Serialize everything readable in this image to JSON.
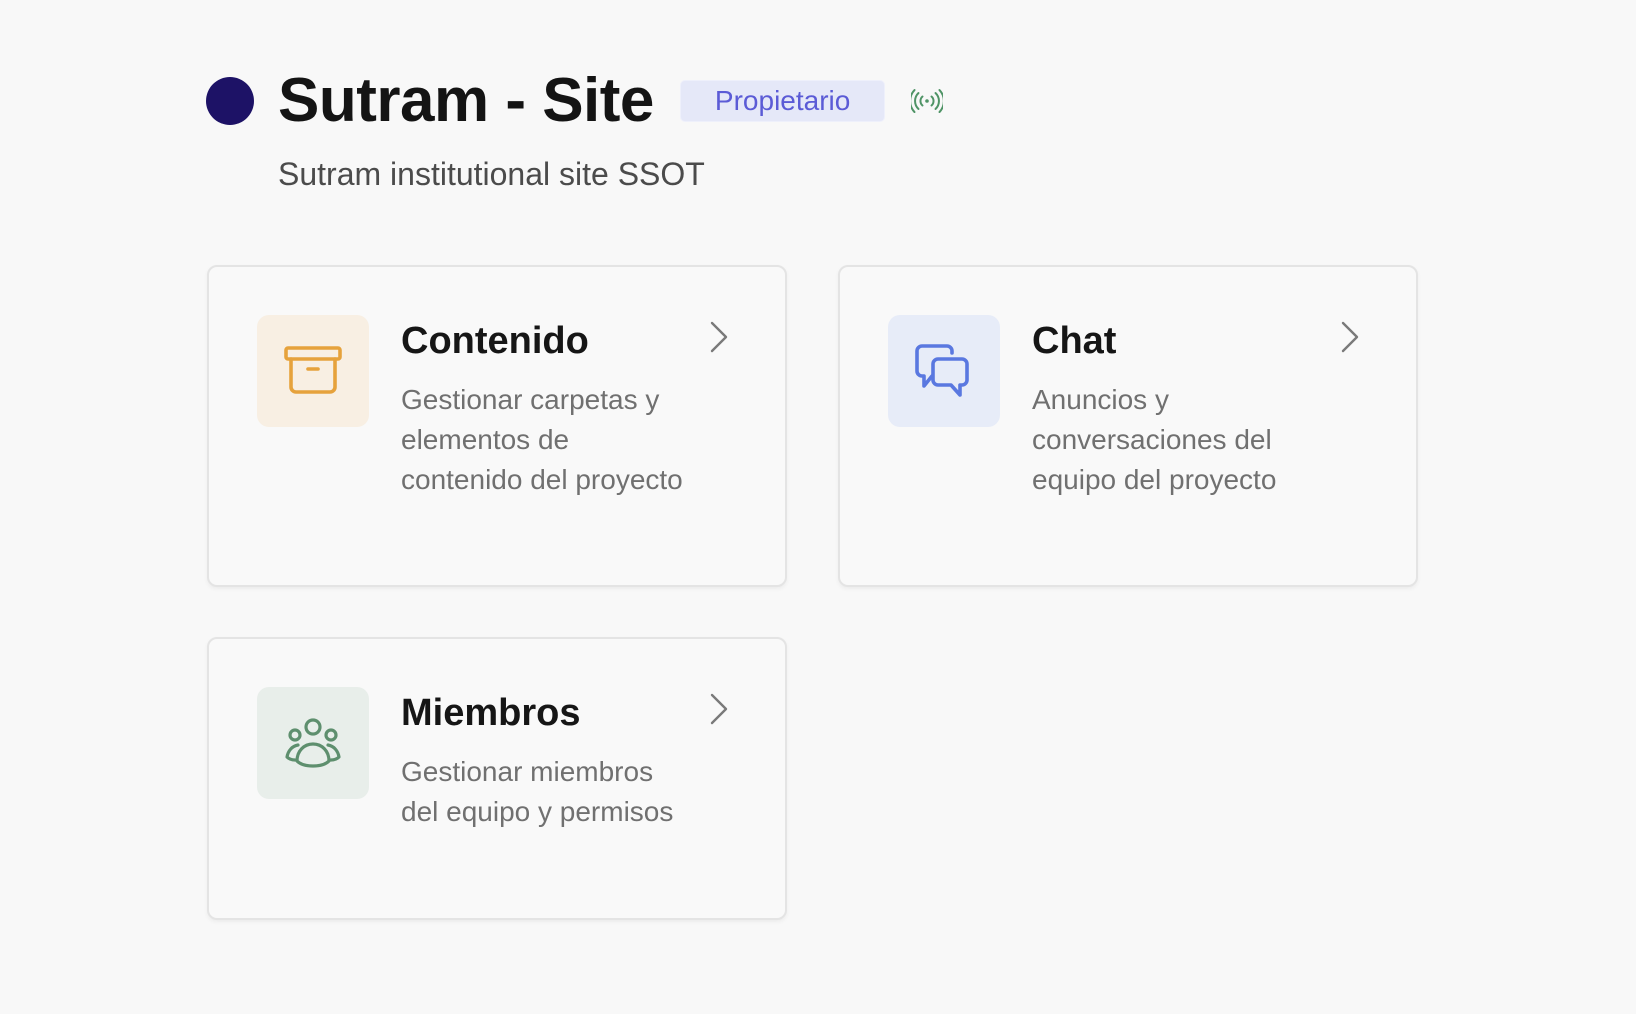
{
  "project": {
    "title": "Sutram - Site",
    "role_badge": "Propietario",
    "subtitle": "Sutram institutional site SSOT",
    "dot_color": "#1d1266",
    "status_icon": "broadcast-signal-icon"
  },
  "cards": [
    {
      "title": "Contenido",
      "description": "Gestionar carpetas y elementos de contenido del proyecto",
      "icon": "archive-box-icon",
      "icon_color": "#e6a23c",
      "icon_bg": "#f8efe3"
    },
    {
      "title": "Chat",
      "description": "Anuncios y conversaciones del equipo del proyecto",
      "icon": "chat-bubbles-icon",
      "icon_color": "#5a78e0",
      "icon_bg": "#e7ecf8"
    },
    {
      "title": "Miembros",
      "description": "Gestionar miembros del equipo y permisos",
      "icon": "users-group-icon",
      "icon_color": "#5e8f6e",
      "icon_bg": "#e8eeea"
    }
  ],
  "colors": {
    "badge_text": "#5b5bd6",
    "badge_bg": "#e5e8f8",
    "signal": "#4f9466",
    "page_bg": "#f8f8f8"
  }
}
